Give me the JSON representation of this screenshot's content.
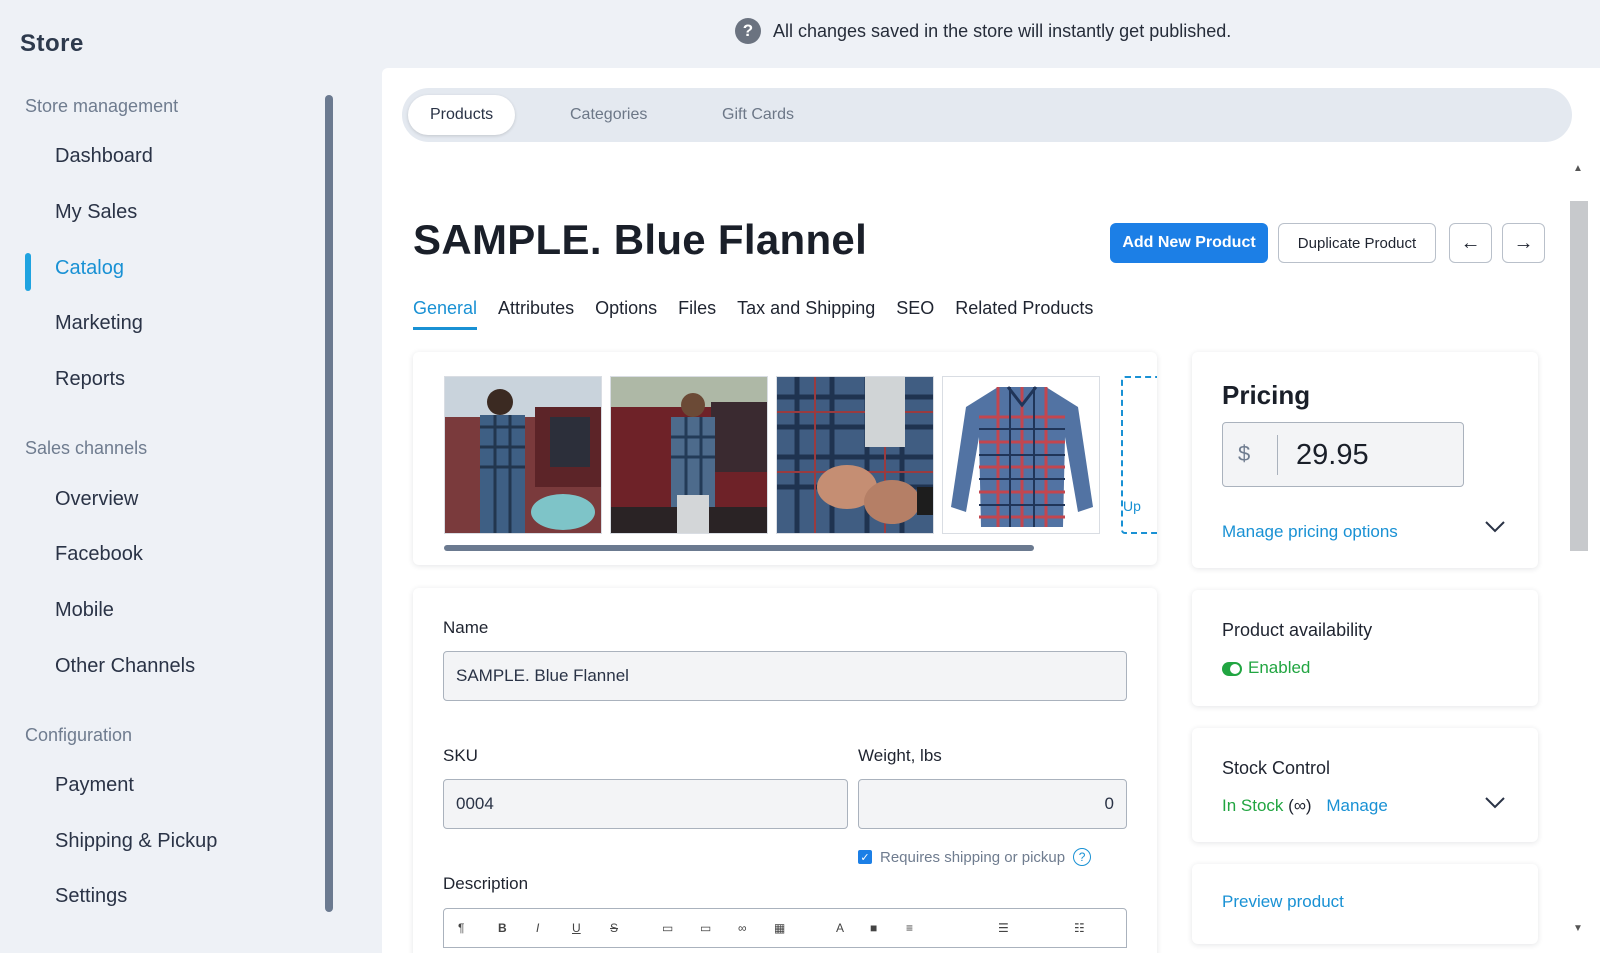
{
  "sidebar": {
    "title": "Store",
    "sections": [
      {
        "label": "Store management",
        "items": [
          "Dashboard",
          "My Sales",
          "Catalog",
          "Marketing",
          "Reports"
        ]
      },
      {
        "label": "Sales channels",
        "items": [
          "Overview",
          "Facebook",
          "Mobile",
          "Other Channels"
        ]
      },
      {
        "label": "Configuration",
        "items": [
          "Payment",
          "Shipping & Pickup",
          "Settings"
        ]
      }
    ],
    "active_item": "Catalog"
  },
  "notice": {
    "icon": "help-icon",
    "text": "All changes saved in the store will instantly get published."
  },
  "top_tabs": [
    "Products",
    "Categories",
    "Gift Cards"
  ],
  "active_top_tab": "Products",
  "product": {
    "title": "SAMPLE. Blue Flannel",
    "add_button": "Add New Product",
    "duplicate_button": "Duplicate Product",
    "prev_icon": "arrow-left-icon",
    "next_icon": "arrow-right-icon",
    "sub_tabs": [
      "General",
      "Attributes",
      "Options",
      "Files",
      "Tax and Shipping",
      "SEO",
      "Related Products"
    ],
    "active_sub_tab": "General",
    "upload_label": "Up"
  },
  "form": {
    "name_label": "Name",
    "name_value": "SAMPLE. Blue Flannel",
    "sku_label": "SKU",
    "sku_value": "0004",
    "weight_label": "Weight, lbs",
    "weight_value": "0",
    "requires_shipping": "Requires shipping or pickup",
    "description_label": "Description"
  },
  "pricing": {
    "title": "Pricing",
    "currency": "$",
    "price": "29.95",
    "manage_link": "Manage pricing options"
  },
  "availability": {
    "title": "Product availability",
    "status": "Enabled"
  },
  "stock": {
    "title": "Stock Control",
    "status": "In Stock",
    "infinite": "(∞)",
    "manage_link": "Manage"
  },
  "preview": {
    "link": "Preview product"
  },
  "colors": {
    "accent": "#1991d4",
    "primary_button": "#1c7fe6",
    "success": "#21a541"
  }
}
